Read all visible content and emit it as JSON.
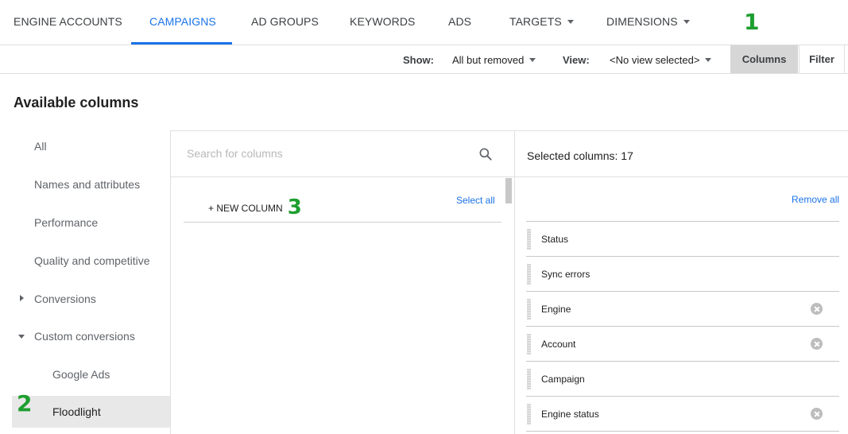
{
  "nav": {
    "tabs": [
      {
        "label": "ENGINE ACCOUNTS",
        "active": false
      },
      {
        "label": "CAMPAIGNS",
        "active": true
      },
      {
        "label": "AD GROUPS",
        "active": false
      },
      {
        "label": "KEYWORDS",
        "active": false
      },
      {
        "label": "ADS",
        "active": false
      },
      {
        "label": "TARGETS",
        "active": false,
        "dropdown": true
      },
      {
        "label": "DIMENSIONS",
        "active": false,
        "dropdown": true
      }
    ],
    "accent_color": "#1a73e8"
  },
  "annotations": {
    "one": "1",
    "two": "2",
    "three": "3",
    "color": "#1e9e2f"
  },
  "toolbar": {
    "show_label": "Show:",
    "show_value": "All but removed",
    "view_label": "View:",
    "view_value": "<No view selected>",
    "columns_button": "Columns",
    "filter_button": "Filter"
  },
  "heading": "Available columns",
  "categories": [
    {
      "label": "All"
    },
    {
      "label": "Names and attributes"
    },
    {
      "label": "Performance"
    },
    {
      "label": "Quality and competitive"
    },
    {
      "label": "Conversions",
      "expander": "collapsed"
    },
    {
      "label": "Custom conversions",
      "expander": "expanded"
    },
    {
      "label": "Google Ads",
      "sub": true
    },
    {
      "label": "Floodlight",
      "sub": true,
      "selected": true
    }
  ],
  "middle": {
    "search_placeholder": "Search for columns",
    "new_column": "+ NEW COLUMN",
    "select_all": "Select all"
  },
  "right": {
    "title": "Selected columns: 17",
    "remove_all": "Remove all",
    "columns": [
      {
        "label": "Status",
        "removable": false
      },
      {
        "label": "Sync errors",
        "removable": false
      },
      {
        "label": "Engine",
        "removable": true
      },
      {
        "label": "Account",
        "removable": true
      },
      {
        "label": "Campaign",
        "removable": false
      },
      {
        "label": "Engine status",
        "removable": true
      }
    ]
  }
}
